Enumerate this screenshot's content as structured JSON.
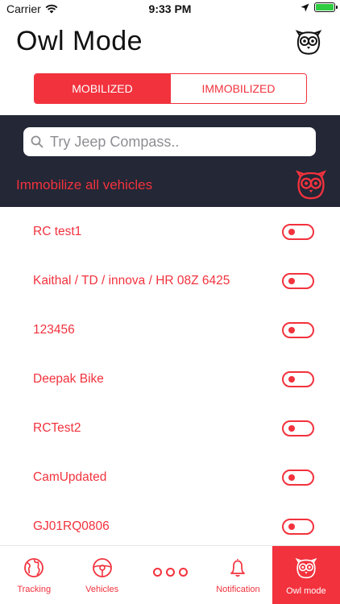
{
  "status_bar": {
    "carrier": "Carrier",
    "time": "9:33 PM",
    "icons": [
      "wifi-icon",
      "location-arrow-icon",
      "battery-icon"
    ]
  },
  "header": {
    "title": "Owl Mode",
    "owl_icon": "owl-icon"
  },
  "segments": {
    "mobilized": "MOBILIZED",
    "immobilized": "IMMOBILIZED",
    "selected": "MOBILIZED"
  },
  "search": {
    "placeholder": "Try Jeep Compass.."
  },
  "immobilize_all": {
    "label": "Immobilize all vehicles",
    "icon": "owl-icon"
  },
  "vehicles": [
    {
      "name": "RC test1"
    },
    {
      "name": "Kaithal / TD / innova / HR 08Z 6425"
    },
    {
      "name": "123456"
    },
    {
      "name": "Deepak Bike"
    },
    {
      "name": "RCTest2"
    },
    {
      "name": "CamUpdated"
    },
    {
      "name": "GJ01RQ0806"
    }
  ],
  "tabbar": {
    "tabs": [
      {
        "label": "Tracking",
        "icon": "globe-icon"
      },
      {
        "label": "Vehicles",
        "icon": "steering-wheel-icon"
      },
      {
        "label": "",
        "icon": "more-dots-icon"
      },
      {
        "label": "Notification",
        "icon": "bell-icon"
      },
      {
        "label": "Owl mode",
        "icon": "owl-icon"
      }
    ],
    "active": "Owl mode"
  },
  "colors": {
    "accent": "#f2323d",
    "panel": "#232736",
    "battery": "#2ecc40"
  }
}
